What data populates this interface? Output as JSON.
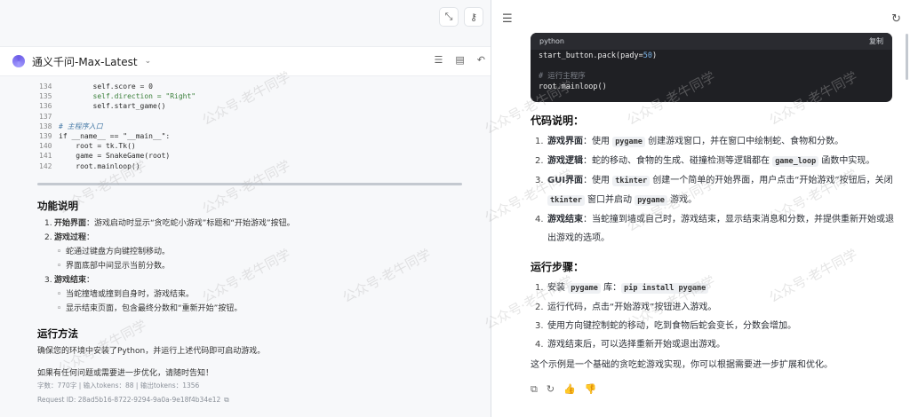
{
  "left": {
    "model_name": "通义千问-Max-Latest",
    "code_lines": [
      {
        "num": "134",
        "text": "        self.score = 0"
      },
      {
        "num": "135",
        "text": "        self.direction = \"Right\""
      },
      {
        "num": "136",
        "text": "        self.start_game()"
      },
      {
        "num": "137",
        "text": ""
      },
      {
        "num": "138",
        "text": "# 主程序入口"
      },
      {
        "num": "139",
        "text": "if __name__ == \"__main__\":"
      },
      {
        "num": "140",
        "text": "    root = tk.Tk()"
      },
      {
        "num": "141",
        "text": "    game = SnakeGame(root)"
      },
      {
        "num": "142",
        "text": "    root.mainloop()"
      }
    ],
    "features_title": "功能说明",
    "features": [
      {
        "num": "1.",
        "label": "开始界面",
        "text": "：游戏启动时显示“贪吃蛇小游戏”标题和“开始游戏”按钮。",
        "subs": []
      },
      {
        "num": "2.",
        "label": "游戏过程",
        "text": "：",
        "subs": [
          "蛇通过键盘方向键控制移动。",
          "界面底部中间显示当前分数。"
        ]
      },
      {
        "num": "3.",
        "label": "游戏结束",
        "text": "：",
        "subs": [
          "当蛇撞墙或撞到自身时，游戏结束。",
          "显示结束页面，包含最终分数和“重新开始”按钮。"
        ]
      }
    ],
    "run_title": "运行方法",
    "run_text": "确保您的环境中安装了Python，并运行上述代码即可启动游戏。",
    "closing_text": "如果有任何问题或需要进一步优化，请随时告知！",
    "meta_line": "字数：770字 | 输入tokens：88 | 输出tokens：1356",
    "request_id": "Request ID: 28ad5b16-8722-9294-9a0a-9e18f4b34e12"
  },
  "right": {
    "code_lang": "python",
    "copy_label": "复制",
    "code_line1_a": "start_button.pack(pady=",
    "code_line1_num": "50",
    "code_line1_b": ")",
    "code_comment": "# 运行主程序",
    "code_line3": "root.mainloop()",
    "explain_title": "代码说明：",
    "explain_items": [
      {
        "num": "1.",
        "label": "游戏界面",
        "p1": "：使用 ",
        "c1": "pygame",
        "p2": " 创建游戏窗口，并在窗口中绘制蛇、食物和分数。",
        "c2": "",
        "p3": "",
        "c3": "",
        "p4": ""
      },
      {
        "num": "2.",
        "label": "游戏逻辑",
        "p1": "：蛇的移动、食物的生成、碰撞检测等逻辑都在 ",
        "c1": "game_loop",
        "p2": " 函数中实现。",
        "c2": "",
        "p3": "",
        "c3": "",
        "p4": ""
      },
      {
        "num": "3.",
        "label": "GUI界面",
        "p1": "：使用 ",
        "c1": "tkinter",
        "p2": " 创建一个简单的开始界面，用户点击“开始游戏”按钮后，关闭 ",
        "c2": "tkinter",
        "p3": " 窗口并启动 ",
        "c3": "pygame",
        "p4": " 游戏。"
      },
      {
        "num": "4.",
        "label": "游戏结束",
        "p1": "：当蛇撞到墙或自己时，游戏结束，显示结束消息和分数，并提供重新开始或退出游戏的选项。",
        "c1": "",
        "p2": "",
        "c2": "",
        "p3": "",
        "c3": "",
        "p4": ""
      }
    ],
    "steps_title": "运行步骤：",
    "step1_a": "安装 ",
    "step1_code1": "pygame",
    "step1_b": " 库：",
    "step1_code2": "pip install pygame",
    "steps": [
      {
        "num": "2.",
        "text": "运行代码，点击“开始游戏”按钮进入游戏。"
      },
      {
        "num": "3.",
        "text": "使用方向键控制蛇的移动，吃到食物后蛇会变长，分数会增加。"
      },
      {
        "num": "4.",
        "text": "游戏结束后，可以选择重新开始或退出游戏。"
      }
    ],
    "summary": "这个示例是一个基础的贪吃蛇游戏实现，你可以根据需要进一步扩展和优化。"
  },
  "watermark": "公众号·老牛同学"
}
